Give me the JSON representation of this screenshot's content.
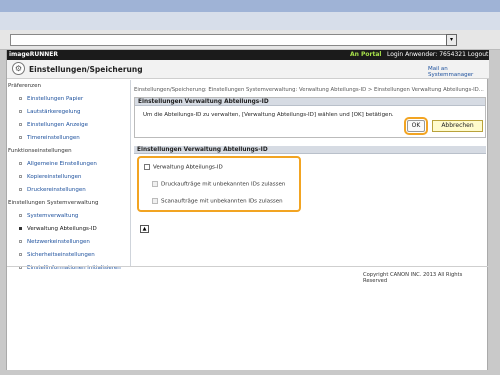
{
  "browser": {
    "dropdown_arrow": "▾"
  },
  "header": {
    "brand": "imageRUNNER",
    "portal_link": "An Portal",
    "login_info": "Login Anwender: 7654321 Logout"
  },
  "title_bar": {
    "title": "Einstellungen/Speicherung",
    "mail_link": "Mail an Systemmanager"
  },
  "sidebar": {
    "sections": [
      {
        "title": "Präferenzen",
        "items": [
          "Einstellungen Papier",
          "Lautstärkeregelung",
          "Einstellungen Anzeige",
          "Timereinstellungen"
        ]
      },
      {
        "title": "Funktionseinstellungen",
        "items": [
          "Allgemeine Einstellungen",
          "Kopiereinstellungen",
          "Druckereinstellungen"
        ]
      },
      {
        "title": "Einstellungen Systemverwaltung",
        "items": [
          "Systemverwaltung",
          "Verwaltung Abteilungs-ID",
          "Netzwerkeinstellungen",
          "Sicherheitseinstellungen",
          "Einstellinformationen initialisieren"
        ]
      }
    ],
    "active_item": "Verwaltung Abteilungs-ID"
  },
  "main": {
    "breadcrumb": "Einstellungen/Speicherung: Einstellungen Systemverwaltung: Verwaltung Abteilungs-ID > Einstellungen Verwaltung Abteilungs-ID...",
    "panel1": {
      "title": "Einstellungen Verwaltung Abteilungs-ID",
      "message": "Um die Abteilungs-ID zu verwalten, [Verwaltung Abteilungs-ID] wählen und [OK] betätigen.",
      "ok_label": "OK",
      "cancel_label": "Abbrechen"
    },
    "panel2": {
      "title": "Einstellungen Verwaltung Abteilungs-ID",
      "options": [
        {
          "label": "Verwaltung Abteilungs-ID",
          "checked": false
        },
        {
          "label": "Druckaufträge mit unbekannten IDs zulassen",
          "checked": false
        },
        {
          "label": "Scanaufträge mit unbekannten IDs zulassen",
          "checked": false
        }
      ]
    },
    "top_button": "▲"
  },
  "footer": {
    "copyright": "Copyright CANON INC. 2013 All Rights Reserved"
  },
  "colors": {
    "accent_highlight": "#f2a422",
    "header_bg": "#1b1b1b",
    "portal_green": "#a7e14a",
    "link_blue": "#1b4f9c"
  }
}
